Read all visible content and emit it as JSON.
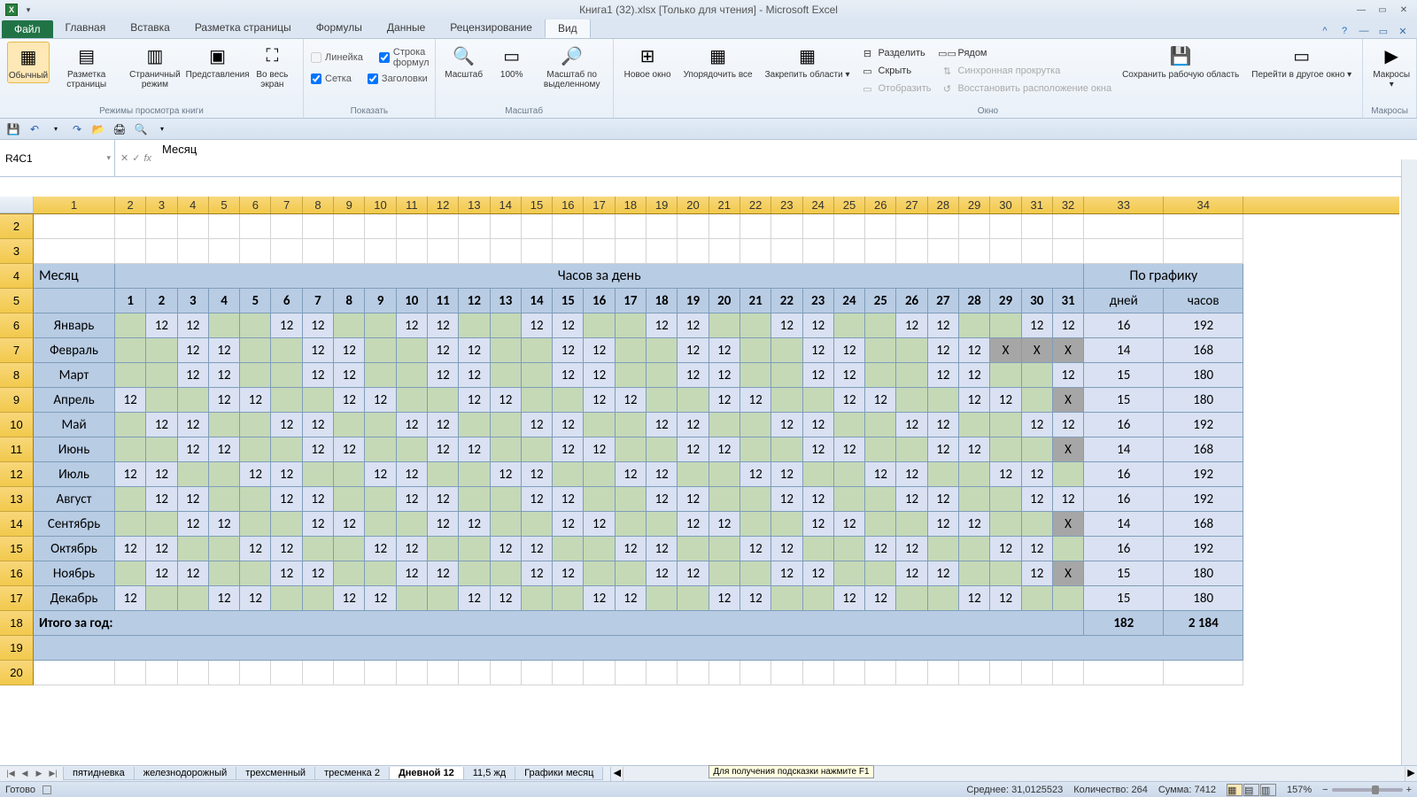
{
  "title": "Книга1 (32).xlsx  [Только для чтения]  -  Microsoft Excel",
  "ribbon_tabs": [
    "Главная",
    "Вставка",
    "Разметка страницы",
    "Формулы",
    "Данные",
    "Рецензирование",
    "Вид"
  ],
  "file_tab": "Файл",
  "active_tab": "Вид",
  "ribbon": {
    "modes": {
      "label": "Режимы просмотра книги",
      "normal": "Обычный",
      "page_layout": "Разметка страницы",
      "page_break": "Страничный режим",
      "custom": "Представления",
      "full": "Во весь экран"
    },
    "show": {
      "label": "Показать",
      "ruler": "Линейка",
      "formula_bar": "Строка формул",
      "gridlines": "Сетка",
      "headings": "Заголовки"
    },
    "zoom": {
      "label": "Масштаб",
      "zoom": "Масштаб",
      "z100": "100%",
      "zsel": "Масштаб по выделенному"
    },
    "window": {
      "label": "Окно",
      "new": "Новое окно",
      "arrange": "Упорядочить все",
      "freeze": "Закрепить области",
      "split": "Разделить",
      "hide": "Скрыть",
      "unhide": "Отобразить",
      "side": "Рядом",
      "sync": "Синхронная прокрутка",
      "reset": "Восстановить расположение окна",
      "save_ws": "Сохранить рабочую область",
      "switch": "Перейти в другое окно"
    },
    "macros": {
      "label": "Макросы",
      "btn": "Макросы"
    }
  },
  "namebox": "R4C1",
  "formula": "Месяц",
  "col_headers": [
    "1",
    "2",
    "3",
    "4",
    "5",
    "6",
    "7",
    "8",
    "9",
    "10",
    "11",
    "12",
    "13",
    "14",
    "15",
    "16",
    "17",
    "18",
    "19",
    "20",
    "21",
    "22",
    "23",
    "24",
    "25",
    "26",
    "27",
    "28",
    "29",
    "30",
    "31",
    "32",
    "33",
    "34"
  ],
  "row_headers": [
    "2",
    "3",
    "4",
    "5",
    "6",
    "7",
    "8",
    "9",
    "10",
    "11",
    "12",
    "13",
    "14",
    "15",
    "16",
    "17",
    "18",
    "19",
    "20"
  ],
  "table": {
    "month_label": "Месяц",
    "hours_per_day": "Часов за день",
    "by_schedule": "По графику",
    "days": "дней",
    "hours": "часов",
    "day_nums": [
      "1",
      "2",
      "3",
      "4",
      "5",
      "6",
      "7",
      "8",
      "9",
      "10",
      "11",
      "12",
      "13",
      "14",
      "15",
      "16",
      "17",
      "18",
      "19",
      "20",
      "21",
      "22",
      "23",
      "24",
      "25",
      "26",
      "27",
      "28",
      "29",
      "30",
      "31"
    ],
    "months": [
      {
        "name": "Январь",
        "cells": [
          "",
          "12",
          "12",
          "",
          "",
          "12",
          "12",
          "",
          "",
          "12",
          "12",
          "",
          "",
          "12",
          "12",
          "",
          "",
          "12",
          "12",
          "",
          "",
          "12",
          "12",
          "",
          "",
          "12",
          "12",
          "",
          "",
          "12",
          "12"
        ],
        "days": "16",
        "hours": "192"
      },
      {
        "name": "Февраль",
        "cells": [
          "",
          "",
          "12",
          "12",
          "",
          "",
          "12",
          "12",
          "",
          "",
          "12",
          "12",
          "",
          "",
          "12",
          "12",
          "",
          "",
          "12",
          "12",
          "",
          "",
          "12",
          "12",
          "",
          "",
          "12",
          "12",
          "X",
          "X",
          "X"
        ],
        "days": "14",
        "hours": "168"
      },
      {
        "name": "Март",
        "cells": [
          "",
          "",
          "12",
          "12",
          "",
          "",
          "12",
          "12",
          "",
          "",
          "12",
          "12",
          "",
          "",
          "12",
          "12",
          "",
          "",
          "12",
          "12",
          "",
          "",
          "12",
          "12",
          "",
          "",
          "12",
          "12",
          "",
          "",
          "12"
        ],
        "days": "15",
        "hours": "180"
      },
      {
        "name": "Апрель",
        "cells": [
          "12",
          "",
          "",
          "12",
          "12",
          "",
          "",
          "12",
          "12",
          "",
          "",
          "12",
          "12",
          "",
          "",
          "12",
          "12",
          "",
          "",
          "12",
          "12",
          "",
          "",
          "12",
          "12",
          "",
          "",
          "12",
          "12",
          "",
          "X"
        ],
        "days": "15",
        "hours": "180"
      },
      {
        "name": "Май",
        "cells": [
          "",
          "12",
          "12",
          "",
          "",
          "12",
          "12",
          "",
          "",
          "12",
          "12",
          "",
          "",
          "12",
          "12",
          "",
          "",
          "12",
          "12",
          "",
          "",
          "12",
          "12",
          "",
          "",
          "12",
          "12",
          "",
          "",
          "12",
          "12"
        ],
        "days": "16",
        "hours": "192"
      },
      {
        "name": "Июнь",
        "cells": [
          "",
          "",
          "12",
          "12",
          "",
          "",
          "12",
          "12",
          "",
          "",
          "12",
          "12",
          "",
          "",
          "12",
          "12",
          "",
          "",
          "12",
          "12",
          "",
          "",
          "12",
          "12",
          "",
          "",
          "12",
          "12",
          "",
          "",
          "X"
        ],
        "days": "14",
        "hours": "168"
      },
      {
        "name": "Июль",
        "cells": [
          "12",
          "12",
          "",
          "",
          "12",
          "12",
          "",
          "",
          "12",
          "12",
          "",
          "",
          "12",
          "12",
          "",
          "",
          "12",
          "12",
          "",
          "",
          "12",
          "12",
          "",
          "",
          "12",
          "12",
          "",
          "",
          "12",
          "12",
          ""
        ],
        "days": "16",
        "hours": "192"
      },
      {
        "name": "Август",
        "cells": [
          "",
          "12",
          "12",
          "",
          "",
          "12",
          "12",
          "",
          "",
          "12",
          "12",
          "",
          "",
          "12",
          "12",
          "",
          "",
          "12",
          "12",
          "",
          "",
          "12",
          "12",
          "",
          "",
          "12",
          "12",
          "",
          "",
          "12",
          "12"
        ],
        "days": "16",
        "hours": "192"
      },
      {
        "name": "Сентябрь",
        "cells": [
          "",
          "",
          "12",
          "12",
          "",
          "",
          "12",
          "12",
          "",
          "",
          "12",
          "12",
          "",
          "",
          "12",
          "12",
          "",
          "",
          "12",
          "12",
          "",
          "",
          "12",
          "12",
          "",
          "",
          "12",
          "12",
          "",
          "",
          "X"
        ],
        "days": "14",
        "hours": "168"
      },
      {
        "name": "Октябрь",
        "cells": [
          "12",
          "12",
          "",
          "",
          "12",
          "12",
          "",
          "",
          "12",
          "12",
          "",
          "",
          "12",
          "12",
          "",
          "",
          "12",
          "12",
          "",
          "",
          "12",
          "12",
          "",
          "",
          "12",
          "12",
          "",
          "",
          "12",
          "12",
          ""
        ],
        "days": "16",
        "hours": "192"
      },
      {
        "name": "Ноябрь",
        "cells": [
          "",
          "12",
          "12",
          "",
          "",
          "12",
          "12",
          "",
          "",
          "12",
          "12",
          "",
          "",
          "12",
          "12",
          "",
          "",
          "12",
          "12",
          "",
          "",
          "12",
          "12",
          "",
          "",
          "12",
          "12",
          "",
          "",
          "12",
          "X"
        ],
        "days": "15",
        "hours": "180"
      },
      {
        "name": "Декабрь",
        "cells": [
          "12",
          "",
          "",
          "12",
          "12",
          "",
          "",
          "12",
          "12",
          "",
          "",
          "12",
          "12",
          "",
          "",
          "12",
          "12",
          "",
          "",
          "12",
          "12",
          "",
          "",
          "12",
          "12",
          "",
          "",
          "12",
          "12",
          "",
          ""
        ],
        "days": "15",
        "hours": "180"
      }
    ],
    "total_label": "Итого за год:",
    "total_days": "182",
    "total_hours": "2 184"
  },
  "sheets": [
    "пятидневка",
    "железнодорожный",
    "трехсменный",
    "тресменка 2",
    "Дневной 12",
    "11,5 жд",
    "Графики месяц"
  ],
  "active_sheet": "Дневной 12",
  "status": {
    "ready": "Готово",
    "avg_l": "Среднее:",
    "avg": "31,0125523",
    "cnt_l": "Количество:",
    "cnt": "264",
    "sum_l": "Сумма:",
    "sum": "7412",
    "zoom": "157%"
  },
  "tooltip": "Для получения подсказки нажмите F1"
}
